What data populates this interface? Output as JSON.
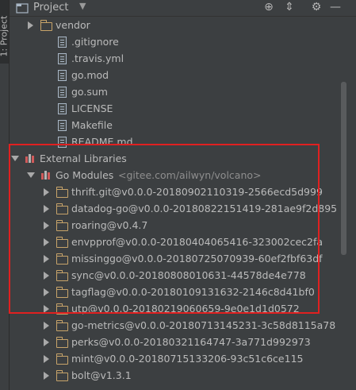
{
  "sidebar": {
    "tab_label": "1: Project"
  },
  "header": {
    "title": "Project",
    "dropdown_icon": "chevron-down",
    "toolbar": [
      "target-icon",
      "collapse-icon",
      "gear-icon",
      "minimize-icon"
    ]
  },
  "tree": {
    "items": [
      {
        "label": "vendor",
        "icon": "folder",
        "arrow": "right"
      },
      {
        "label": ".gitignore",
        "icon": "file"
      },
      {
        "label": ".travis.yml",
        "icon": "file"
      },
      {
        "label": "go.mod",
        "icon": "file"
      },
      {
        "label": "go.sum",
        "icon": "file"
      },
      {
        "label": "LICENSE",
        "icon": "file"
      },
      {
        "label": "Makefile",
        "icon": "file"
      },
      {
        "label": "README.md",
        "icon": "file"
      },
      {
        "label": "External Libraries",
        "icon": "library",
        "arrow": "down"
      },
      {
        "label": "Go Modules",
        "extra": "<gitee.com/ailwyn/volcano>",
        "icon": "library",
        "arrow": "down"
      },
      {
        "label": "thrift.git@v0.0.0-20180902110319-2566ecd5d999",
        "icon": "folder",
        "arrow": "right"
      },
      {
        "label": "datadog-go@v0.0.0-20180822151419-281ae9f2d895",
        "icon": "folder",
        "arrow": "right"
      },
      {
        "label": "roaring@v0.4.7",
        "icon": "folder",
        "arrow": "right"
      },
      {
        "label": "envpprof@v0.0.0-20180404065416-323002cec2fa",
        "icon": "folder",
        "arrow": "right"
      },
      {
        "label": "missinggo@v0.0.0-20180725070939-60ef2fbf63df",
        "icon": "folder",
        "arrow": "right"
      },
      {
        "label": "sync@v0.0.0-20180808010631-44578de4e778",
        "icon": "folder",
        "arrow": "right"
      },
      {
        "label": "tagflag@v0.0.0-20180109131632-2146c8d41bf0",
        "icon": "folder",
        "arrow": "right"
      },
      {
        "label": "utp@v0.0.0-20180219060659-9e0e1d1d0572",
        "icon": "folder",
        "arrow": "right"
      },
      {
        "label": "go-metrics@v0.0.0-20180713145231-3c58d8115a78",
        "icon": "folder",
        "arrow": "right"
      },
      {
        "label": "perks@v0.0.0-20180321164747-3a771d992973",
        "icon": "folder",
        "arrow": "right"
      },
      {
        "label": "mint@v0.0.0-20180715133206-93c51c6ce115",
        "icon": "folder",
        "arrow": "right"
      },
      {
        "label": "bolt@v1.3.1",
        "icon": "folder",
        "arrow": "right"
      }
    ]
  }
}
